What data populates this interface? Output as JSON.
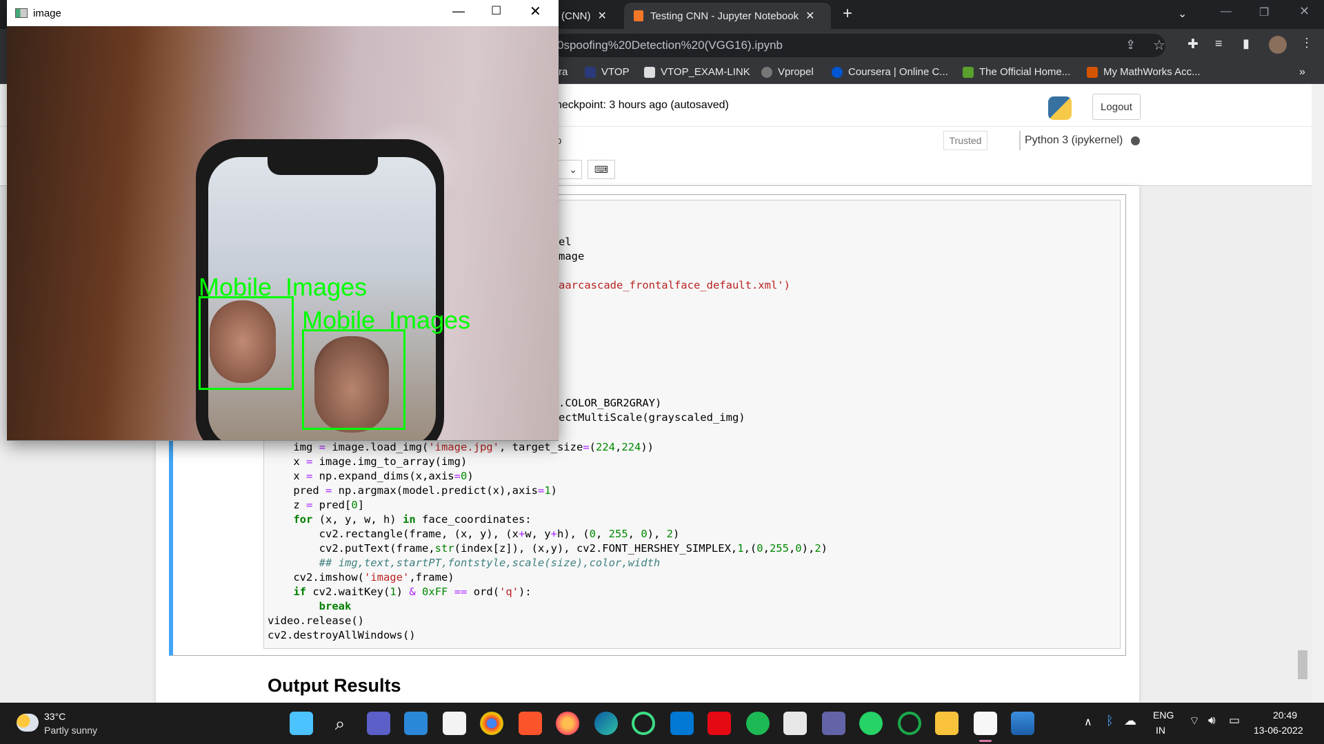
{
  "browser": {
    "tabs": [
      {
        "label": "(CNN)"
      },
      {
        "label": "Testing CNN - Jupyter Notebook"
      }
    ],
    "address": "0spoofing%20Detection%20(VGG16).ipynb",
    "bookmarks": [
      {
        "label": "ra"
      },
      {
        "label": "VTOP"
      },
      {
        "label": "VTOP_EXAM-LINK"
      },
      {
        "label": "Vpropel"
      },
      {
        "label": "Coursera | Online C..."
      },
      {
        "label": "The Official Home..."
      },
      {
        "label": "My MathWorks Acc..."
      }
    ]
  },
  "notebook": {
    "checkpoint": "heckpoint: 3 hours ago  (autosaved)",
    "logout": "Logout",
    "menu_fragment": "o",
    "trusted": "Trusted",
    "kernel": "Python 3 (ipykernel)",
    "output_heading": "Output Results"
  },
  "code_partial": {
    "l1": "el",
    "l2": "mage",
    "l3": "aarcascade_frontalface_default.xml')",
    "l4": ".COLOR_BGR2GRAY)",
    "l5": "ectMultiScale(grayscaled_img)"
  },
  "cv_window": {
    "title": "image",
    "labels": [
      "Mobile  Images",
      "Mobile  Images"
    ],
    "box_color": "#00ff00"
  },
  "taskbar": {
    "temp": "33°C",
    "weather": "Partly sunny",
    "lang1": "ENG",
    "lang2": "IN",
    "time": "20:49",
    "date": "13-06-2022"
  }
}
